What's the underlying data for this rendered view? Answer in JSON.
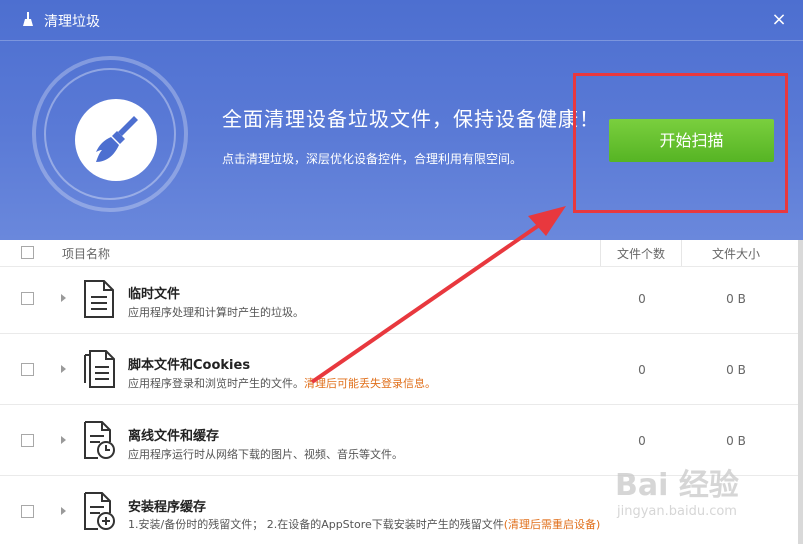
{
  "window": {
    "title": "清理垃圾",
    "close": "×"
  },
  "hero": {
    "headline": "全面清理设备垃圾文件，保持设备健康！",
    "subline": "点击清理垃圾，深层优化设备控件，合理利用有限空间。",
    "scan_button": "开始扫描"
  },
  "table": {
    "headers": {
      "name": "项目名称",
      "count": "文件个数",
      "size": "文件大小"
    },
    "rows": [
      {
        "title": "临时文件",
        "desc": "应用程序处理和计算时产生的垃圾。",
        "warn": "",
        "count": "0",
        "size": "0 B",
        "icon": "document-icon"
      },
      {
        "title": "脚本文件和Cookies",
        "desc": "应用程序登录和浏览时产生的文件。",
        "warn": "清理后可能丢失登录信息。",
        "count": "0",
        "size": "0 B",
        "icon": "documents-stack-icon"
      },
      {
        "title": "离线文件和缓存",
        "desc": "应用程序运行时从网络下载的图片、视频、音乐等文件。",
        "warn": "",
        "count": "0",
        "size": "0 B",
        "icon": "document-clock-icon"
      },
      {
        "title": "安装程序缓存",
        "desc": "1.安装/备份时的残留文件； 2.在设备的AppStore下载安装时产生的残留文件",
        "warn": "(清理后需重启设备)",
        "count": "0",
        "size": "0 B",
        "icon": "document-plus-icon"
      }
    ]
  },
  "watermark": {
    "main": "Bai 经验",
    "sub": "jingyan.baidu.com"
  },
  "colors": {
    "header": "#5a7ad6",
    "scan_button": "#62bd2f",
    "annotation": "#e8383e",
    "warning_text": "#e0701c"
  }
}
